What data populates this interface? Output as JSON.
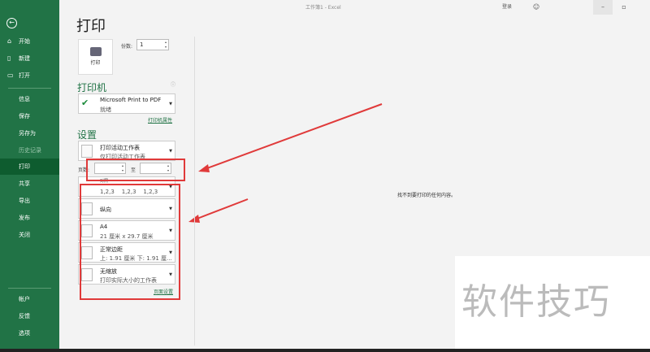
{
  "window": {
    "title": "工作簿1 - Excel",
    "user": "登录",
    "minimize": "–",
    "restore": "▫"
  },
  "sidebar": {
    "back": "←",
    "items": [
      {
        "label": "开始",
        "icon": "⌂"
      },
      {
        "label": "新建",
        "icon": "▯"
      },
      {
        "label": "打开",
        "icon": "▭"
      },
      {
        "label": "信息"
      },
      {
        "label": "保存"
      },
      {
        "label": "另存为"
      },
      {
        "label": "历史记录"
      },
      {
        "label": "打印"
      },
      {
        "label": "共享"
      },
      {
        "label": "导出"
      },
      {
        "label": "发布"
      },
      {
        "label": "关闭"
      },
      {
        "label": "帐户"
      },
      {
        "label": "反馈"
      },
      {
        "label": "选项"
      }
    ]
  },
  "page": {
    "title": "打印",
    "print_button": "打印",
    "copies_label": "份数:",
    "copies_value": "1"
  },
  "printer": {
    "heading": "打印机",
    "name": "Microsoft Print to PDF",
    "status": "就绪",
    "properties_link": "打印机属性",
    "info": "ⓘ"
  },
  "settings": {
    "heading": "设置",
    "what": {
      "l1": "打印活动工作表",
      "l2": "仅打印活动工作表"
    },
    "pages_label": "页数:",
    "to_label": "至",
    "collate": {
      "l1": "对照",
      "l2": "1,2,3    1,2,3    1,2,3"
    },
    "orientation": {
      "l1": "纵向"
    },
    "paper": {
      "l1": "A4",
      "l2": "21 厘米 x 29.7 厘米"
    },
    "margins": {
      "l1": "正常边距",
      "l2": "上: 1.91 厘米 下: 1.91 厘..."
    },
    "scaling": {
      "l1": "无缩放",
      "l2": "打印实际大小的工作表"
    },
    "page_setup_link": "页面设置"
  },
  "preview": {
    "message": "找不到要打印的任何内容。"
  },
  "watermark": "软件技巧",
  "colors": {
    "accent": "#217346",
    "highlight": "#e03a3a"
  }
}
